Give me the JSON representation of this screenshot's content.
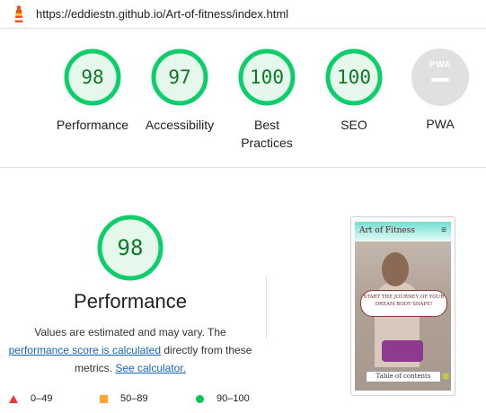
{
  "topbar": {
    "url": "https://eddiestn.github.io/Art-of-fitness/index.html",
    "icon": "lighthouse-icon"
  },
  "colors": {
    "pass_green": "#0cce6b",
    "pass_text": "#0c7b27",
    "pass_fill": "#e6f8ec",
    "link_blue": "#1565c0",
    "fail_red": "#e53935",
    "average_orange": "#ffa726"
  },
  "categories": [
    {
      "id": "performance",
      "score": 98,
      "label": "Performance"
    },
    {
      "id": "accessibility",
      "score": 97,
      "label": "Accessibility"
    },
    {
      "id": "best-practices",
      "score": 100,
      "label": "Best Practices"
    },
    {
      "id": "seo",
      "score": 100,
      "label": "SEO"
    },
    {
      "id": "pwa",
      "score": null,
      "label": "PWA",
      "badge": "PWA",
      "icon": "pwa-icon"
    }
  ],
  "performance": {
    "score": 98,
    "title": "Performance",
    "desc_prefix": "Values are estimated and may vary. The ",
    "score_link": "performance score is calculated",
    "desc_middle": " directly from these metrics. ",
    "calculator_link": "See calculator."
  },
  "legend": [
    {
      "shape": "triangle",
      "range": "0–49"
    },
    {
      "shape": "square",
      "range": "50–89"
    },
    {
      "shape": "circle",
      "range": "90–100"
    }
  ],
  "page_screenshot": {
    "brand": "Art of Fitness",
    "menu_icon": "hamburger-menu-icon",
    "hero_text": "START THE JOURNEY OF YOUR DREAM BODY SHAPE!",
    "toc_button": "Table of contents"
  }
}
